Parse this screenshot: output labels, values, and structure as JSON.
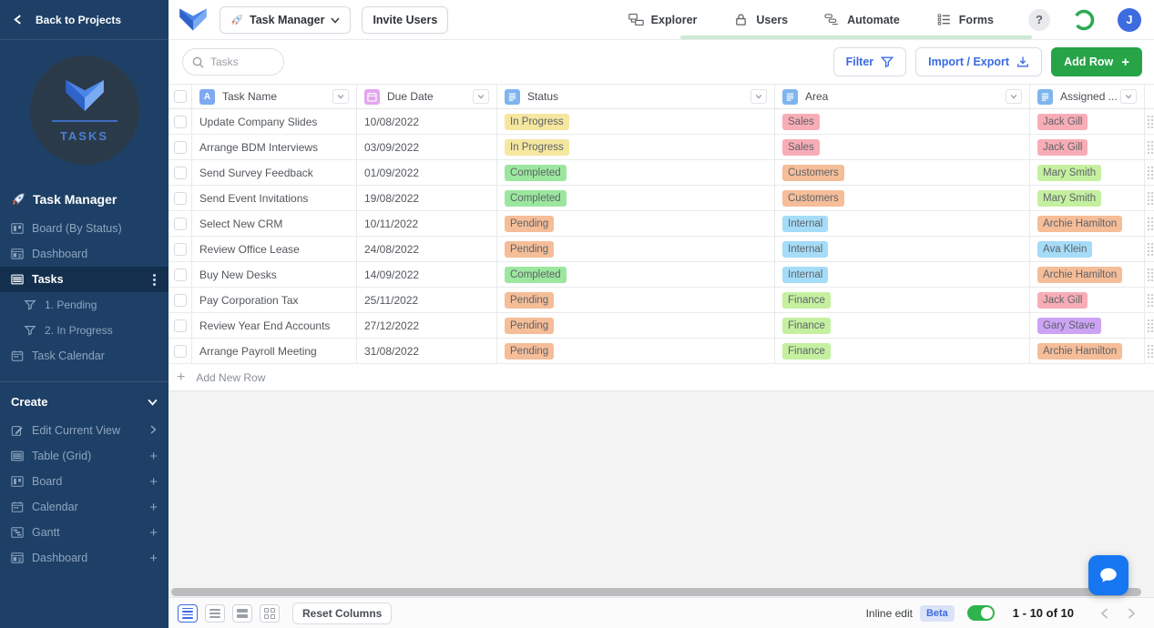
{
  "sidebar": {
    "back_label": "Back to Projects",
    "workspace_name": "TASKS",
    "stack_title": "Task Manager",
    "views": [
      {
        "label": "Board (By Status)",
        "icon": "board",
        "active": false
      },
      {
        "label": "Dashboard",
        "icon": "dashboard",
        "active": false
      },
      {
        "label": "Tasks",
        "icon": "table",
        "active": true
      },
      {
        "label": "1. Pending",
        "icon": "filter",
        "sub": true
      },
      {
        "label": "2. In Progress",
        "icon": "filter",
        "sub": true
      },
      {
        "label": "Task Calendar",
        "icon": "calendar",
        "active": false
      }
    ],
    "create": {
      "header": "Create",
      "items": [
        {
          "label": "Edit Current View",
          "trailing": "chevron"
        },
        {
          "label": "Table (Grid)",
          "trailing": "plus"
        },
        {
          "label": "Board",
          "trailing": "plus"
        },
        {
          "label": "Calendar",
          "trailing": "plus"
        },
        {
          "label": "Gantt",
          "trailing": "plus"
        },
        {
          "label": "Dashboard",
          "trailing": "plus"
        }
      ]
    }
  },
  "header": {
    "stack_switcher_label": "Task Manager",
    "invite_label": "Invite Users",
    "nav": [
      {
        "label": "Explorer"
      },
      {
        "label": "Users"
      },
      {
        "label": "Automate"
      },
      {
        "label": "Forms"
      }
    ],
    "help_label": "?",
    "avatar_initial": "J"
  },
  "toolbar": {
    "search_placeholder": "Tasks",
    "filter_label": "Filter",
    "import_export_label": "Import / Export",
    "add_row_label": "Add Row"
  },
  "table": {
    "columns": [
      {
        "label": "Task Name",
        "type": "text"
      },
      {
        "label": "Due Date",
        "type": "date"
      },
      {
        "label": "Status",
        "type": "select"
      },
      {
        "label": "Area",
        "type": "select"
      },
      {
        "label": "Assigned ...",
        "type": "select"
      }
    ],
    "rows": [
      {
        "task": "Update Company Slides",
        "due": "10/08/2022",
        "status": "In Progress",
        "area": "Sales",
        "assigned": "Jack Gill"
      },
      {
        "task": "Arrange BDM Interviews",
        "due": "03/09/2022",
        "status": "In Progress",
        "area": "Sales",
        "assigned": "Jack Gill"
      },
      {
        "task": "Send Survey Feedback",
        "due": "01/09/2022",
        "status": "Completed",
        "area": "Customers",
        "assigned": "Mary Smith"
      },
      {
        "task": "Send Event Invitations",
        "due": "19/08/2022",
        "status": "Completed",
        "area": "Customers",
        "assigned": "Mary Smith"
      },
      {
        "task": "Select New CRM",
        "due": "10/11/2022",
        "status": "Pending",
        "area": "Internal",
        "assigned": "Archie Hamilton"
      },
      {
        "task": "Review Office Lease",
        "due": "24/08/2022",
        "status": "Pending",
        "area": "Internal",
        "assigned": "Ava Klein"
      },
      {
        "task": "Buy New Desks",
        "due": "14/09/2022",
        "status": "Completed",
        "area": "Internal",
        "assigned": "Archie Hamilton"
      },
      {
        "task": "Pay Corporation Tax",
        "due": "25/11/2022",
        "status": "Pending",
        "area": "Finance",
        "assigned": "Jack Gill"
      },
      {
        "task": "Review Year End Accounts",
        "due": "27/12/2022",
        "status": "Pending",
        "area": "Finance",
        "assigned": "Gary Stave"
      },
      {
        "task": "Arrange Payroll Meeting",
        "due": "31/08/2022",
        "status": "Pending",
        "area": "Finance",
        "assigned": "Archie Hamilton"
      }
    ],
    "add_new_row_label": "Add New Row",
    "chip_colors": {
      "In Progress": "#F5E7A0",
      "Completed": "#9CE79F",
      "Pending": "#F5BD98",
      "Sales": "#F8ADB6",
      "Customers": "#F5BD98",
      "Internal": "#A5DCF7",
      "Finance": "#C5F0A0",
      "Jack Gill": "#F8ADB6",
      "Mary Smith": "#C5F0A0",
      "Archie Hamilton": "#F5BD98",
      "Ava Klein": "#A5DCF7",
      "Gary Stave": "#CDA3F5"
    }
  },
  "footer": {
    "reset_columns_label": "Reset Columns",
    "inline_edit_label": "Inline edit",
    "beta_label": "Beta",
    "range_label": "1 - 10 of 10"
  },
  "colors": {
    "sidebar_bg": "#1E4066",
    "accent_blue": "#3A6AE3",
    "add_row_green": "#27A348",
    "toggle_green": "#2FB34D",
    "avatar_blue": "#3D6BE0",
    "chat_fab_blue": "#1776F1",
    "nav_progress_green": "#CDE8D4"
  }
}
